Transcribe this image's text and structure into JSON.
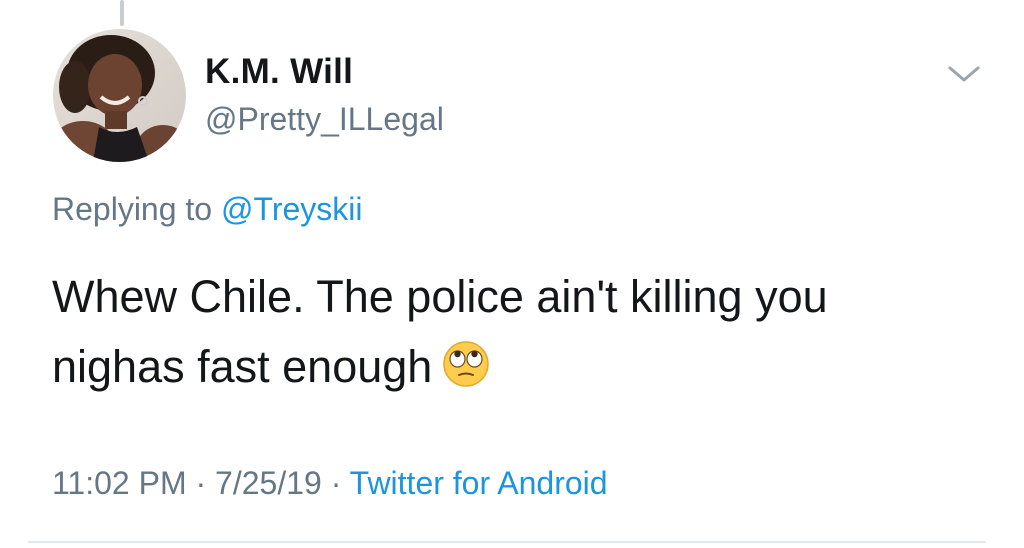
{
  "tweet": {
    "display_name": "K.M. Will",
    "handle": "@Pretty_ILLegal",
    "replying_prefix": "Replying to ",
    "replying_handle": "@Treyskii",
    "text_line1": "Whew Chile. The police ain't killing you",
    "text_line2": "nighas fast enough",
    "emoji": "face-with-rolling-eyes",
    "time": "11:02 PM",
    "separator": " · ",
    "date": "7/25/19",
    "source": "Twitter for Android",
    "avatar_icon": "avatar-photo",
    "menu_icon": "chevron-down-icon"
  },
  "colors": {
    "text_primary": "#14171a",
    "text_secondary": "#657786",
    "link": "#1b95e0",
    "divider": "#e1e8ed"
  }
}
